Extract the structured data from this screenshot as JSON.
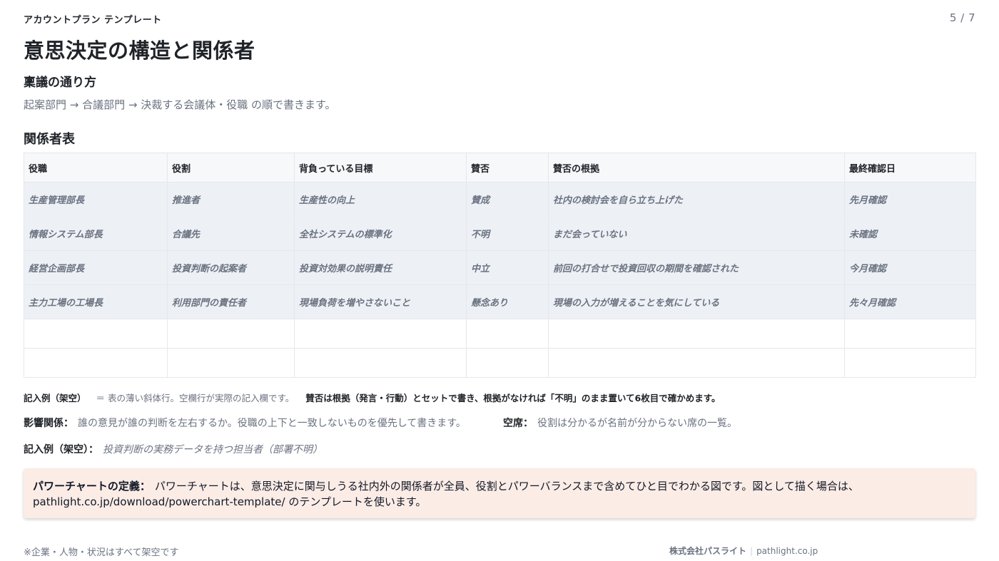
{
  "header": {
    "template_label": "アカウントプラン テンプレート",
    "page_number": "5 / 7",
    "title": "意思決定の構造と関係者"
  },
  "approval": {
    "heading": "稟議の通り方",
    "flow": "起案部門 → 合議部門 → 決裁する会議体・役職 の順で書きます。"
  },
  "stakeholders": {
    "heading": "関係者表",
    "columns": [
      "役職",
      "役割",
      "背負っている目標",
      "賛否",
      "賛否の根拠",
      "最終確認日"
    ],
    "rows": [
      [
        "生産管理部長",
        "推進者",
        "生産性の向上",
        "賛成",
        "社内の検討会を自ら立ち上げた",
        "先月確認"
      ],
      [
        "情報システム部長",
        "合議先",
        "全社システムの標準化",
        "不明",
        "まだ会っていない",
        "未確認"
      ],
      [
        "経営企画部長",
        "投資判断の起案者",
        "投資対効果の説明責任",
        "中立",
        "前回の打合せで投資回収の期間を確認された",
        "今月確認"
      ],
      [
        "主力工場の工場長",
        "利用部門の責任者",
        "現場負荷を増やさないこと",
        "懸念あり",
        "現場の入力が増えることを気にしている",
        "先々月確認"
      ]
    ]
  },
  "legend": {
    "tag": "記入例（架空）",
    "description": "＝ 表の薄い斜体行。空欄行が実際の記入欄です。",
    "note": "賛否は根拠（発言・行動）とセットで書き、根拠がなければ「不明」のまま置いて6枚目で確かめます。"
  },
  "influence": {
    "label": "影響関係：",
    "text": "誰の意見が誰の判断を左右するか。役職の上下と一致しないものを優先して書きます。"
  },
  "vacant": {
    "label": "空席：",
    "text": "役割は分かるが名前が分からない席の一覧。"
  },
  "example": {
    "label": "記入例（架空）：",
    "text": "投資判断の実務データを持つ担当者（部署不明）"
  },
  "callout": {
    "label": "パワーチャートの定義：",
    "text": "パワーチャートは、意思決定に関与しうる社内外の関係者が全員、役割とパワーバランスまで含めてひと目でわかる図です。図として描く場合は、pathlight.co.jp/download/powerchart-template/ のテンプレートを使います。"
  },
  "footer": {
    "disclaimer": "※企業・人物・状況はすべて架空です",
    "company": "株式会社パスライト",
    "separator": "|",
    "domain": "pathlight.co.jp"
  }
}
